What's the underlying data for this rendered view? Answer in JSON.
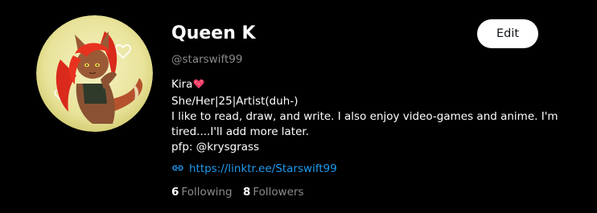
{
  "profile": {
    "display_name": "Queen K",
    "handle": "@starswift99",
    "edit_label": "Edit",
    "bio": {
      "line1": "Kira",
      "line2": "She/Her|25|Artist(duh-)",
      "line3": "I like to read, draw, and write. I also enjoy video-games and anime. I'm",
      "line4": "tired....I'll add more later.",
      "line5": "pfp: @krysgrass"
    },
    "link": "https://linktr.ee/Starswift99",
    "stats": {
      "following_count": "6",
      "following_label": "Following",
      "followers_count": "8",
      "followers_label": "Followers"
    }
  },
  "icons": {
    "heart": "sparkling-heart-icon",
    "link": "link-icon"
  },
  "colors": {
    "background": "#000000",
    "primary_text": "#ffffff",
    "secondary_text": "#8b8b8b",
    "link": "#1d9bf0",
    "button_bg": "#ffffff",
    "button_text": "#0f1419",
    "avatar_bg": "#e9e6a6"
  }
}
